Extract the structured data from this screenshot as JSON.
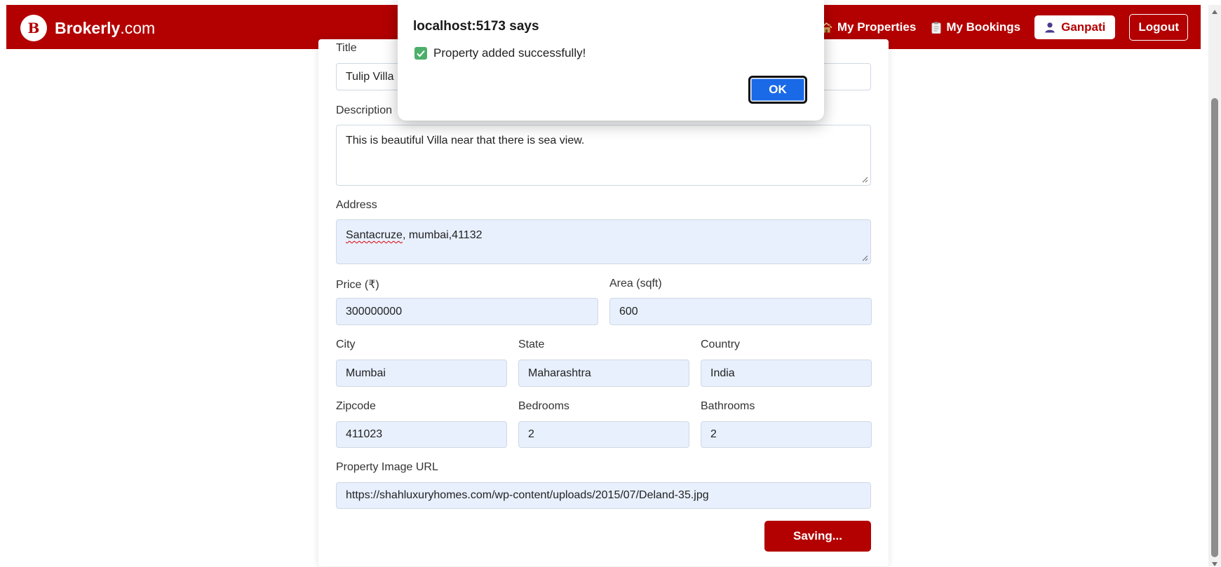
{
  "navbar": {
    "brand_logo_letter": "B",
    "brand_name": "Brokerly",
    "brand_suffix": ".com",
    "links": [
      {
        "label": "My Properties",
        "icon": "house-icon"
      },
      {
        "label": "My Bookings",
        "icon": "clipboard-icon"
      }
    ],
    "user": {
      "label": "Ganpati",
      "icon": "user-icon"
    },
    "logout_label": "Logout"
  },
  "form": {
    "title_label": "Title",
    "title_value": "Tulip Villa",
    "description_label": "Description",
    "description_value": "This is beautiful Villa near that there is sea view.",
    "address_label": "Address",
    "address_misspelled": "Santacruze",
    "address_rest": ", mumbai,41132",
    "price_label": "Price (₹)",
    "price_value": "300000000",
    "area_label": "Area (sqft)",
    "area_value": "600",
    "city_label": "City",
    "city_value": "Mumbai",
    "state_label": "State",
    "state_value": "Maharashtra",
    "country_label": "Country",
    "country_value": "India",
    "zipcode_label": "Zipcode",
    "zipcode_value": "411023",
    "bedrooms_label": "Bedrooms",
    "bedrooms_value": "2",
    "bathrooms_label": "Bathrooms",
    "bathrooms_value": "2",
    "image_url_label": "Property Image URL",
    "image_url_value": "https://shahluxuryhomes.com/wp-content/uploads/2015/07/Deland-35.jpg",
    "submit_label": "Saving..."
  },
  "dialog": {
    "title": "localhost:5173 says",
    "message": "Property added successfully!",
    "message_icon": "check-icon",
    "ok_label": "OK"
  },
  "colors": {
    "brand": "#b30000",
    "input_bg": "#e8f0fe",
    "ok_button": "#1a6ae8"
  }
}
